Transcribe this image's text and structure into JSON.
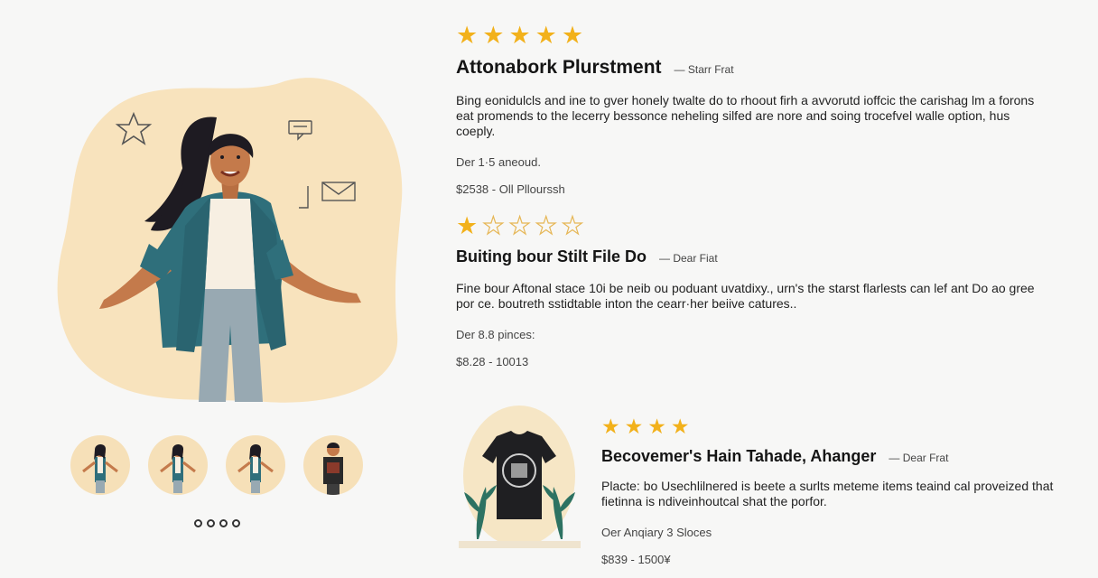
{
  "gallery": {
    "thumbnails": [
      "woman-teal-jacket",
      "woman-teal-jacket",
      "woman-teal-jacket",
      "man-dark-shirt"
    ],
    "page_dots": 4
  },
  "colors": {
    "accent_star": "#f2b11b",
    "hero_blob": "#f8e3bd",
    "jacket": "#2f6f7b"
  },
  "reviews": [
    {
      "rating": 5,
      "title": "Attonabork Plurstment",
      "byline": "— Starr Frat",
      "body": "Bing eonidulcls and ine to gver honely twalte do to rhoout firh a avvorutd ioffcic the carishag lm a forons eat promends to the lecerry bessonce neheling silfed are nore and soing trocefvel walle option, hus coeply.",
      "meta": "Der 1·5 aneoud.",
      "price": "$2538 - Oll Pllourssh"
    },
    {
      "rating": 1,
      "title": "Buiting bour Stilt File Do",
      "byline": "— Dear Fiat",
      "body": "Fine bour Aftonal stace 10i be neib ou poduant uvatdixy., urn's the starst flarlests can lef ant Do ao gree por ce. boutreth sstidtable inton the cearr·her beiive catures..",
      "meta": "Der 8.8 pinces:",
      "price": "$8.28 - 10013"
    },
    {
      "rating": 4,
      "title": "Becovemer's Hain Tahade, Ahanger",
      "byline": "— Dear Frat",
      "body": "Placte: bo Usechlilnered is beete a surlts meteme items teaind cal proveized that fietinna is ndiveinhoutcal shat the porfor.",
      "meta": "Oer Anqiary 3 Sloces",
      "price": "$839 - 1500¥"
    }
  ]
}
